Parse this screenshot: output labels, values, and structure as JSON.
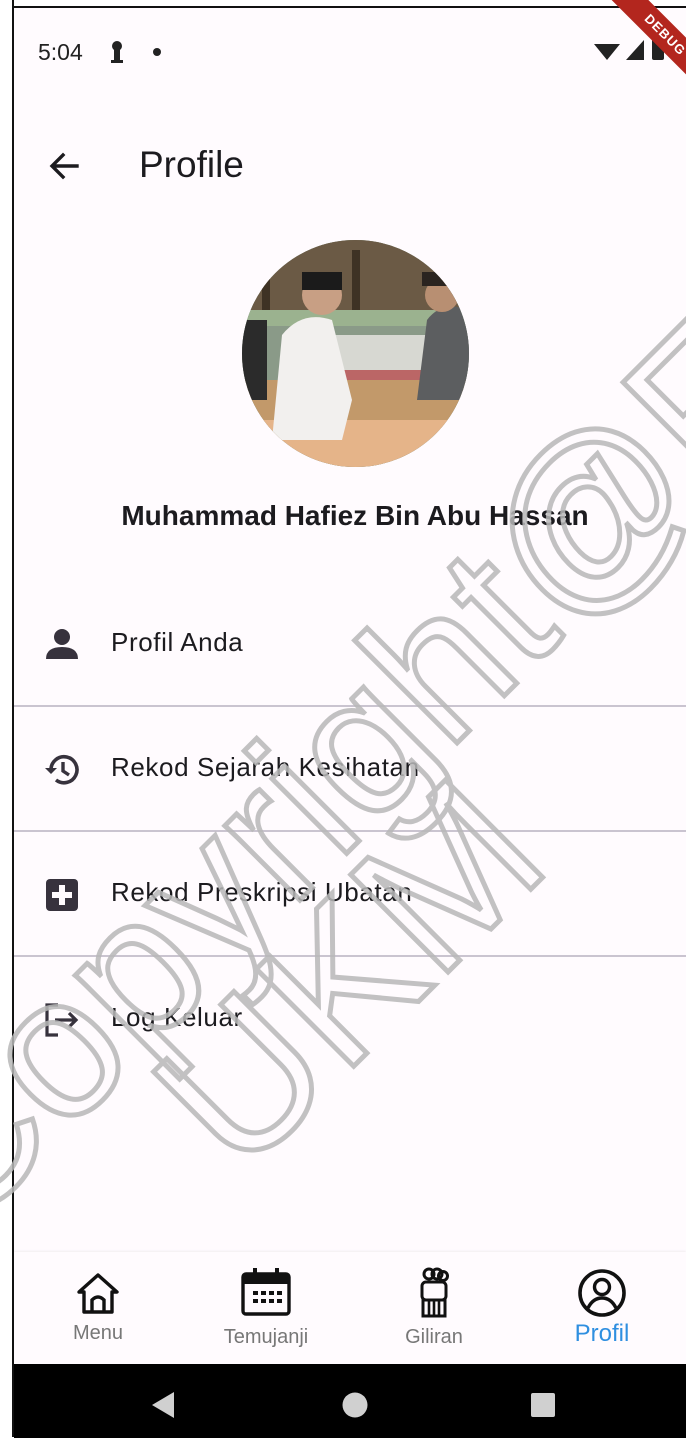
{
  "status_bar": {
    "time": "5:04",
    "debug_banner": "DEBUG"
  },
  "app_bar": {
    "title": "Profile",
    "back_icon": "arrow-back-icon"
  },
  "profile": {
    "name": "Muhammad Hafiez Bin Abu Hassan"
  },
  "menu": {
    "items": [
      {
        "label": "Profil Anda",
        "icon": "person-icon"
      },
      {
        "label": "Rekod Sejarah Kesihatan",
        "icon": "history-icon"
      },
      {
        "label": "Rekod Preskripsi Ubatan",
        "icon": "medical-plus-icon"
      },
      {
        "label": "Log Keluar",
        "icon": "logout-icon"
      }
    ]
  },
  "watermark": {
    "line1": "Copyright@FTSM",
    "line2": "UKM"
  },
  "bottom_nav": {
    "items": [
      {
        "label": "Menu",
        "icon": "home-icon",
        "active": false
      },
      {
        "label": "Temujanji",
        "icon": "calendar-icon",
        "active": false
      },
      {
        "label": "Giliran",
        "icon": "queue-icon",
        "active": false
      },
      {
        "label": "Profil",
        "icon": "account-circle-icon",
        "active": true
      }
    ],
    "active_color": "#2f8fe0",
    "inactive_color": "#777777"
  },
  "system_nav": {
    "buttons": [
      "back-triangle-icon",
      "home-circle-icon",
      "recents-square-icon"
    ]
  }
}
